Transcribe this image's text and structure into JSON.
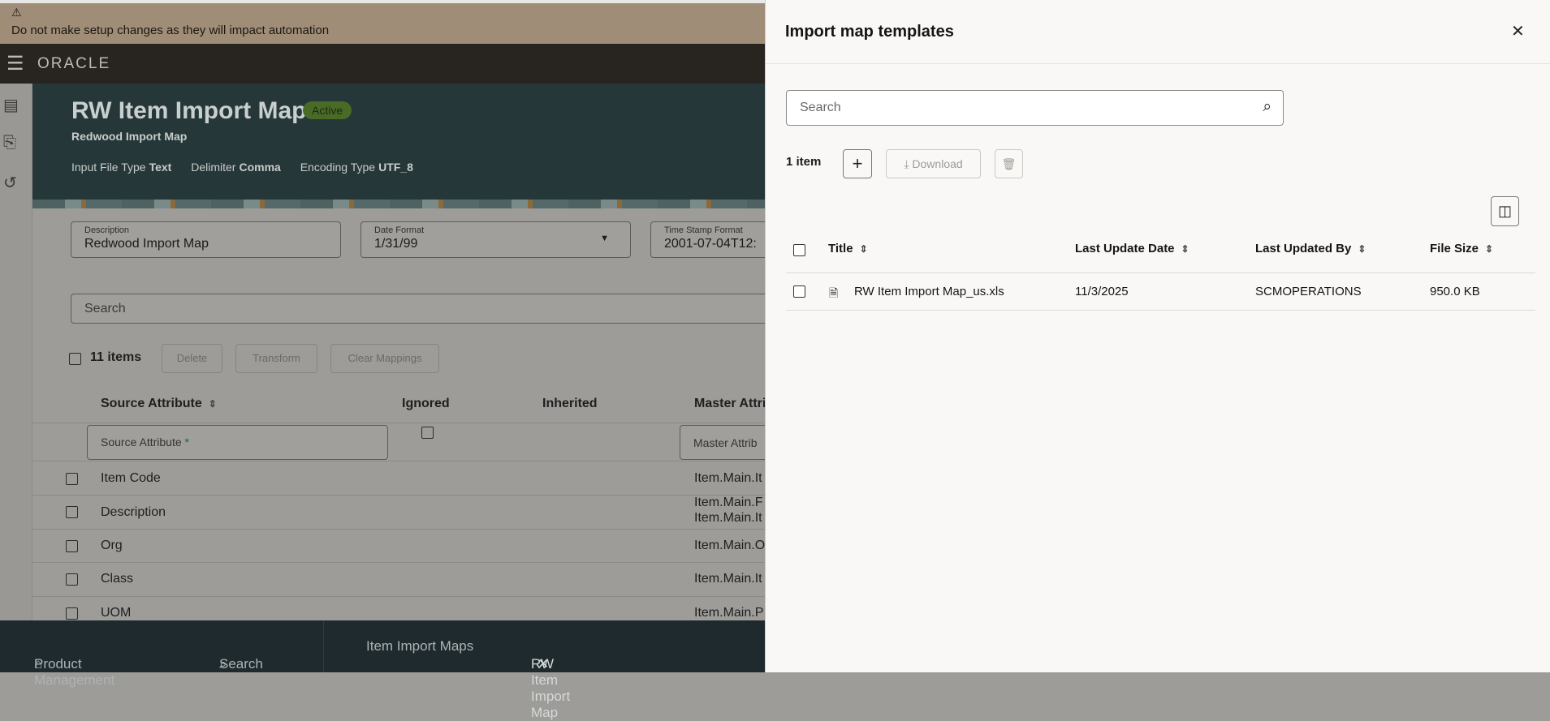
{
  "banner": {
    "icon": "warning-icon",
    "message": "Do not make setup changes as they will impact automation"
  },
  "appbar": {
    "logo": "ORACLE"
  },
  "hero": {
    "title": "RW Item Import Map",
    "status": "Active",
    "subtitle": "Redwood Import Map",
    "meta": [
      {
        "label": "Input File Type",
        "value": "Text"
      },
      {
        "label": "Delimiter",
        "value": "Comma"
      },
      {
        "label": "Encoding Type",
        "value": "UTF_8"
      }
    ]
  },
  "form": {
    "description": {
      "label": "Description",
      "value": "Redwood Import Map"
    },
    "date_format": {
      "label": "Date Format",
      "value": "1/31/99"
    },
    "timestamp_format": {
      "label": "Time Stamp Format",
      "value": "2001-07-04T12:"
    }
  },
  "mapping": {
    "search_placeholder": "Search",
    "count": "11 items",
    "buttons": {
      "delete": "Delete",
      "transform": "Transform",
      "clear": "Clear Mappings"
    },
    "columns": [
      "Source Attribute",
      "Ignored",
      "Inherited",
      "Master Attri"
    ],
    "filter": {
      "source_placeholder": "Source Attribute",
      "required": "*",
      "master_placeholder": "Master Attrib"
    },
    "rows": [
      {
        "source": "Item Code",
        "master": "Item.Main.It"
      },
      {
        "source": "Description",
        "master": "Item.Main.F",
        "master2": "Item.Main.It"
      },
      {
        "source": "Org",
        "master": "Item.Main.O"
      },
      {
        "source": "Class",
        "master": "Item.Main.It"
      },
      {
        "source": "UOM",
        "master": "Item.Main.P"
      }
    ]
  },
  "bottom_nav": {
    "home": "Product Management",
    "search": "Search",
    "tab1": "Item Import Maps",
    "tab2": "RW Item Import Map"
  },
  "panel": {
    "title": "Import map templates",
    "search_placeholder": "Search",
    "count": "1 item",
    "download": "Download",
    "columns": [
      "Title",
      "Last Update Date",
      "Last Updated By",
      "File Size"
    ],
    "rows": [
      {
        "title": "RW Item Import Map_us.xls",
        "date": "11/3/2025",
        "by": "SCMOPERATIONS",
        "size": "950.0 KB"
      }
    ]
  }
}
